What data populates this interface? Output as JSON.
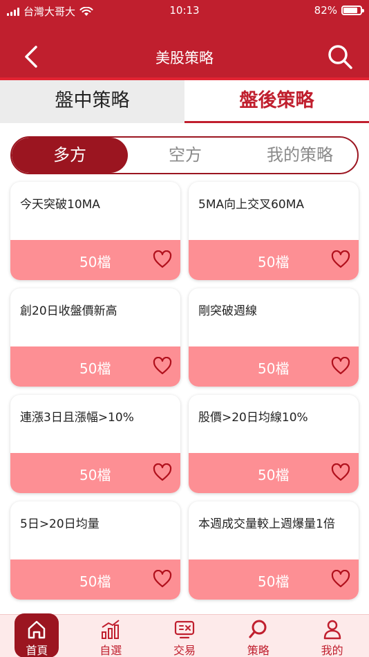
{
  "status": {
    "carrier": "台灣大哥大",
    "time": "10:13",
    "battery": "82%",
    "battery_level": 0.82
  },
  "header": {
    "title": "美股策略",
    "back_icon": "chevron-left-icon",
    "search_icon": "search-icon"
  },
  "main_tabs": [
    {
      "label": "盤中策略",
      "active": false
    },
    {
      "label": "盤後策略",
      "active": true
    }
  ],
  "segment": [
    {
      "label": "多方",
      "active": true
    },
    {
      "label": "空方",
      "active": false
    },
    {
      "label": "我的策略",
      "active": false
    }
  ],
  "cards": [
    {
      "title": "今天突破10MA",
      "count": "50檔"
    },
    {
      "title": "5MA向上交叉60MA",
      "count": "50檔"
    },
    {
      "title": "創20日收盤價新高",
      "count": "50檔"
    },
    {
      "title": "剛突破週線",
      "count": "50檔"
    },
    {
      "title": "連漲3日且漲幅>10%",
      "count": "50檔"
    },
    {
      "title": "股價>20日均線10%",
      "count": "50檔"
    },
    {
      "title": "5日>20日均量",
      "count": "50檔"
    },
    {
      "title": "本週成交量較上週爆量1倍",
      "count": "50檔"
    }
  ],
  "nav": [
    {
      "label": "首頁",
      "icon": "home-icon",
      "active": true
    },
    {
      "label": "自選",
      "icon": "bar-chart-icon",
      "active": false
    },
    {
      "label": "交易",
      "icon": "trade-icon",
      "active": false
    },
    {
      "label": "策略",
      "icon": "search-icon",
      "active": false
    },
    {
      "label": "我的",
      "icon": "user-icon",
      "active": false
    }
  ],
  "colors": {
    "brand": "#c01f2e",
    "dark": "#9b1520",
    "card_bottom": "#fd8f94",
    "nav_bg": "#fdeaea"
  }
}
